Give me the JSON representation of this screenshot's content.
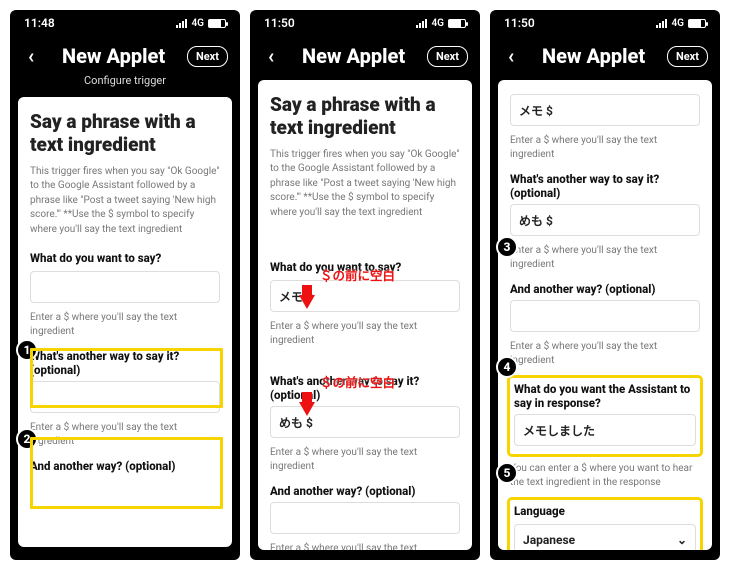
{
  "status": {
    "time1": "11:48",
    "time2": "11:50",
    "time3": "11:50",
    "netlabel": "4G"
  },
  "appbar": {
    "title": "New Applet",
    "next": "Next",
    "sub1": "Configure trigger"
  },
  "heading": "Say a phrase with a text ingredient",
  "desc": "This trigger fires when you say \"Ok Google\" to the Google Assistant followed by a phrase like \"Post a tweet saying 'New high score.'\" **Use the $ symbol to specify where you'll say the text ingredient",
  "q1": {
    "label": "What do you want to say?",
    "hint": "Enter a $ where you'll say the text ingredient",
    "value2": "メモ $"
  },
  "q2": {
    "label": "What's another way to say it? (optional)",
    "hint": "Enter a $ where you'll say the text ingredient",
    "value2": "めも $"
  },
  "q3": {
    "label": "And another way? (optional)",
    "hint": "Enter a $ where you'll say the text ingredient"
  },
  "q4": {
    "label": "What do you want the Assistant to say in response?",
    "hint": "You can enter a $ where you want to hear the text ingredient in the response",
    "value3": "メモしました"
  },
  "q5": {
    "label": "Language",
    "value3": "Japanese"
  },
  "p3top": {
    "memo": "メモ $",
    "hint": "Enter a $ where you'll say the text ingredient"
  },
  "anno": {
    "red": "＄の前に空白"
  },
  "badges": {
    "n1": "1",
    "n2": "2",
    "n3": "3",
    "n4": "4",
    "n5": "5"
  }
}
